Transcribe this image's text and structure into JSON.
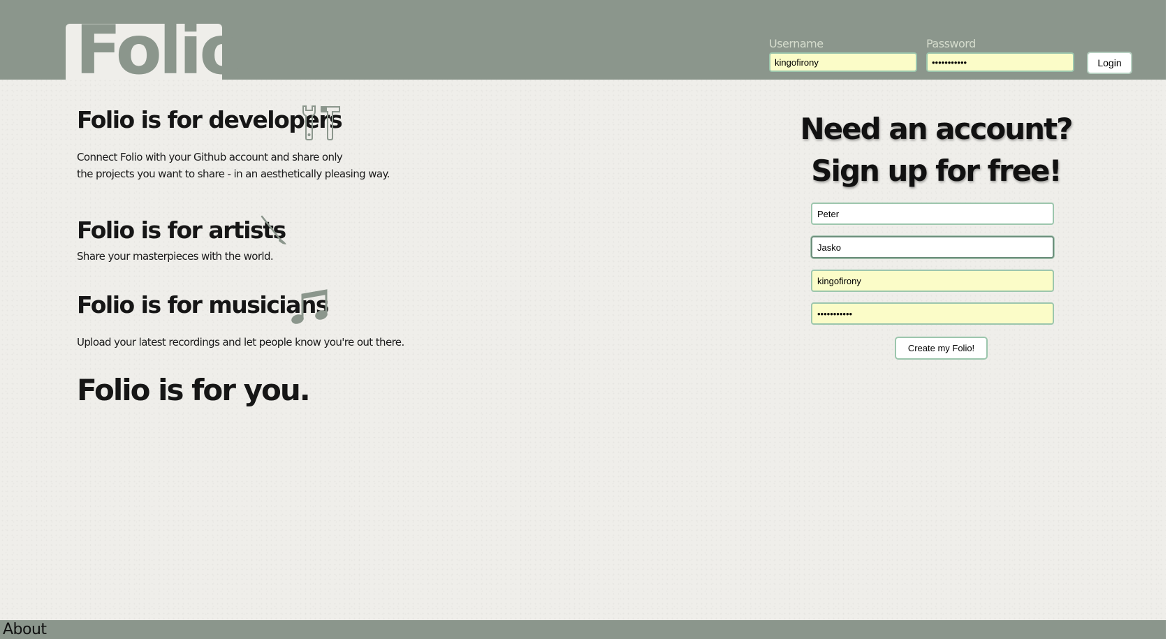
{
  "header": {
    "logo": "Folio",
    "login": {
      "username_label": "Username",
      "username_value": "kingofirony",
      "password_label": "Password",
      "password_value": "kingofirony",
      "login_button": "Login"
    }
  },
  "features": {
    "developers": {
      "title": "Folio is for developers",
      "desc_line1": "Connect Folio with your Github account and share only",
      "desc_line2": "the projects you want to share - in an aesthetically pleasing way.",
      "icon": "tools-icon"
    },
    "artists": {
      "title": "Folio is for artists",
      "desc": "Share your masterpieces with the world.",
      "icon": "paintbrush-icon"
    },
    "musicians": {
      "title": "Folio is for musicians",
      "desc": "Upload your latest recordings and let people know you're out there.",
      "icon": "music-note-icon"
    },
    "you_title": "Folio is for you."
  },
  "signup": {
    "heading_line1": "Need an account?",
    "heading_line2": "Sign up for free!",
    "first_name": "Peter",
    "last_name": "Jasko",
    "username": "kingofirony",
    "password": "kingofirony",
    "submit_button": "Create my Folio!"
  },
  "footer": {
    "about": "About"
  },
  "colors": {
    "header_bg": "#8b968c",
    "page_bg": "#efeeea",
    "input_border": "#9cc6ad",
    "autofill_bg": "#fbfcc8"
  }
}
